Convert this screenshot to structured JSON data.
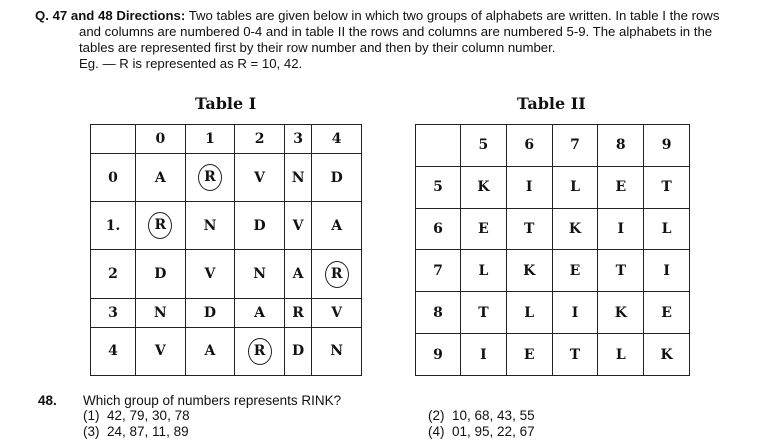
{
  "intro": {
    "q_label": "Q. 47 and 48 Directions:",
    "line1": "Two tables are given below in which two groups of alphabets are written. In table I the rows",
    "line2": "and columns are numbered 0-4 and in table II the rows and columns are numbered 5-9. The alphabets in the",
    "line3": "tables are represented first by their row number and then by their column number.",
    "example": "Eg. — R is represented as R = 10, 42."
  },
  "table1": {
    "title": "Table I",
    "col_headers": [
      "0",
      "1",
      "2",
      "3",
      "4"
    ],
    "rows": [
      {
        "num": "0",
        "cells": [
          "A",
          "R",
          "V",
          "N",
          "D"
        ]
      },
      {
        "num": "1.",
        "cells": [
          "R",
          "N",
          "D",
          "V",
          "A"
        ]
      },
      {
        "num": "2",
        "cells": [
          "D",
          "V",
          "N",
          "A",
          "R"
        ]
      },
      {
        "num": "3",
        "cells": [
          "N",
          "D",
          "A",
          "R",
          "V"
        ]
      },
      {
        "num": "4",
        "cells": [
          "V",
          "A",
          "R",
          "D",
          "N"
        ]
      }
    ]
  },
  "table2": {
    "title": "Table II",
    "col_headers": [
      "5",
      "6",
      "7",
      "8",
      "9"
    ],
    "rows": [
      {
        "num": "5",
        "cells": [
          "K",
          "I",
          "L",
          "E",
          "T"
        ]
      },
      {
        "num": "6",
        "cells": [
          "E",
          "T",
          "K",
          "I",
          "L"
        ]
      },
      {
        "num": "7",
        "cells": [
          "L",
          "K",
          "E",
          "T",
          "I"
        ]
      },
      {
        "num": "8",
        "cells": [
          "T",
          "L",
          "I",
          "K",
          "E"
        ]
      },
      {
        "num": "9",
        "cells": [
          "I",
          "E",
          "T",
          "L",
          "K"
        ]
      }
    ]
  },
  "question": {
    "number": "48.",
    "text": "Which group of numbers represents RINK?",
    "options": [
      {
        "label": "(1)",
        "value": "42, 79, 30, 78"
      },
      {
        "label": "(2)",
        "value": "10, 68, 43, 55"
      },
      {
        "label": "(3)",
        "value": "24, 87, 11, 89"
      },
      {
        "label": "(4)",
        "value": "01, 95, 22, 67"
      }
    ]
  }
}
